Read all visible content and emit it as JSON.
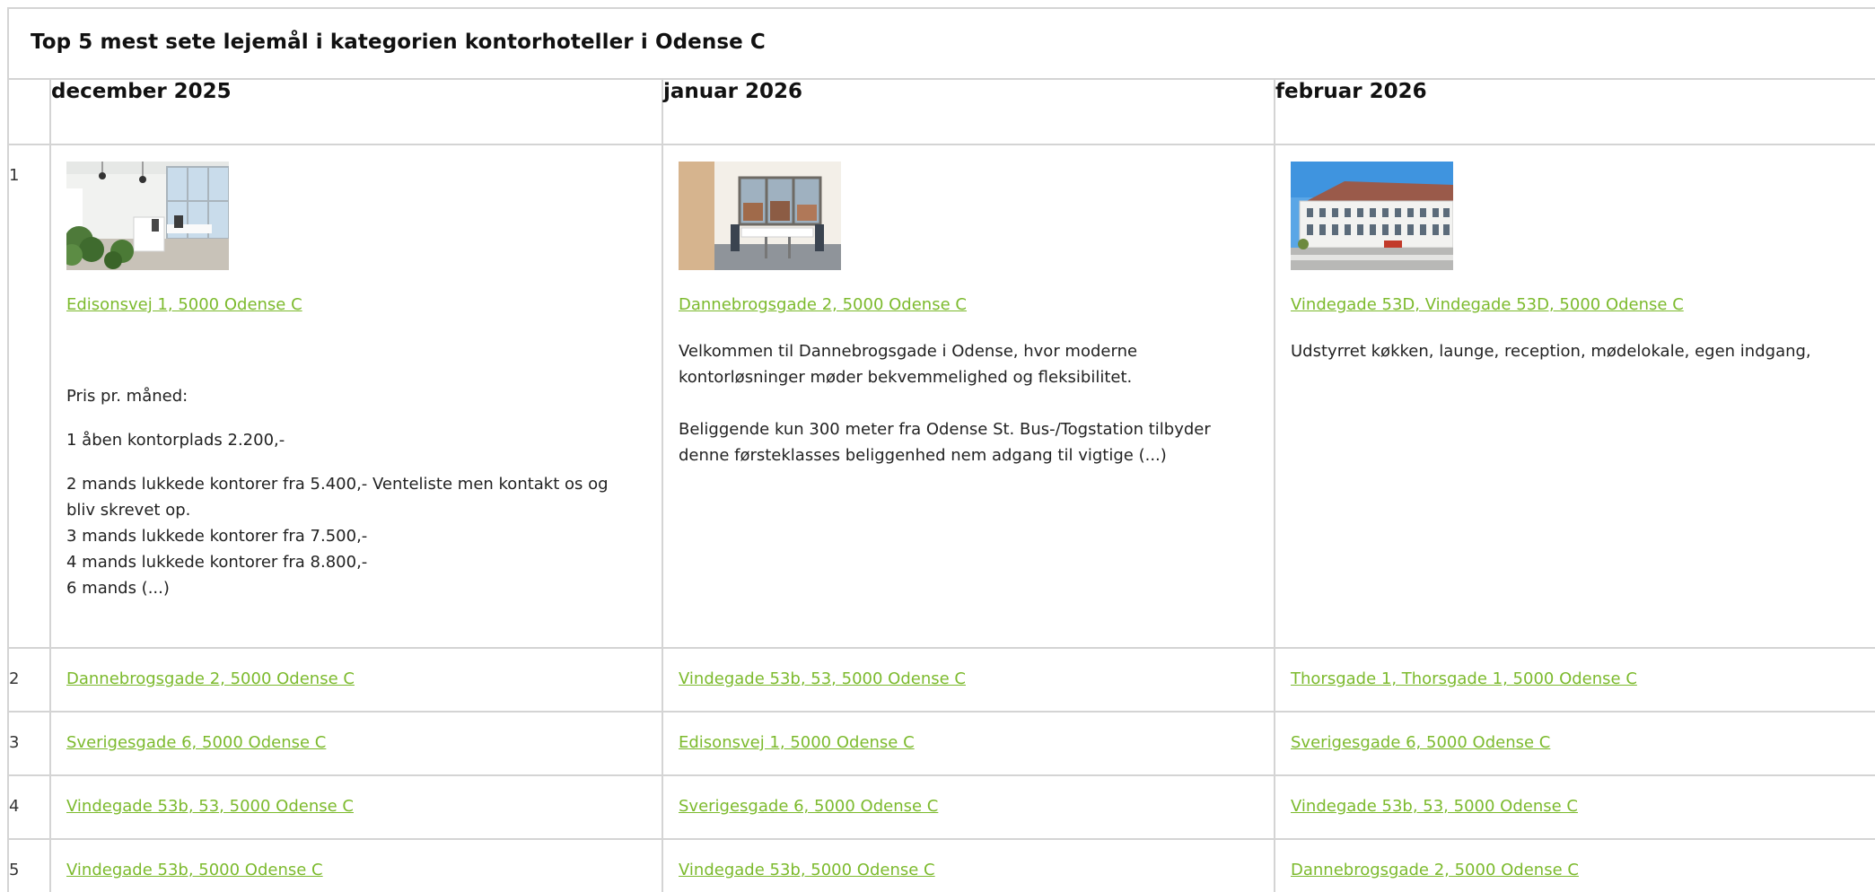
{
  "caption": "Top 5 mest sete lejemål i kategorien kontorhoteller i Odense C",
  "months": [
    "december 2025",
    "januar 2026",
    "februar 2026"
  ],
  "colors": {
    "link": "#7cba2d",
    "border": "#d4d4d4"
  },
  "first_row": {
    "rank": "1",
    "cells": [
      {
        "image": "office-interior-photo",
        "address": "Edisonsvej 1, 5000 Odense C",
        "lines": [
          "Pris pr. måned:",
          "1 åben kontorplads 2.200,-",
          "2 mands lukkede kontorer fra 5.400,- Venteliste men kontakt os og bliv skrevet op.",
          "3 mands lukkede kontorer fra 7.500,-",
          "4 mands lukkede kontorer fra 8.800,-",
          "6 mands (...)"
        ]
      },
      {
        "image": "meeting-room-photo",
        "address": "Dannebrogsgade 2, 5000 Odense C",
        "lines": [
          "Velkommen til Dannebrogsgade i Odense, hvor moderne kontorløsninger møder bekvemmelighed og fleksibilitet.",
          "Beliggende kun 300 meter fra Odense St. Bus-/Togstation tilbyder denne førsteklasses beliggenhed nem adgang til vigtige (...)"
        ]
      },
      {
        "image": "building-exterior-photo",
        "address": "Vindegade 53D, Vindegade 53D, 5000 Odense C",
        "lines": [
          "Udstyrret køkken, launge, reception, mødelokale, egen indgang,"
        ]
      }
    ]
  },
  "rows": [
    {
      "rank": "2",
      "addresses": [
        "Dannebrogsgade 2, 5000 Odense C",
        "Vindegade 53b, 53, 5000 Odense C",
        "Thorsgade 1, Thorsgade 1, 5000 Odense C"
      ]
    },
    {
      "rank": "3",
      "addresses": [
        "Sverigesgade 6, 5000 Odense C",
        "Edisonsvej 1, 5000 Odense C",
        "Sverigesgade 6, 5000 Odense C"
      ]
    },
    {
      "rank": "4",
      "addresses": [
        "Vindegade 53b, 53, 5000 Odense C",
        "Sverigesgade 6, 5000 Odense C",
        "Vindegade 53b, 53, 5000 Odense C"
      ]
    },
    {
      "rank": "5",
      "addresses": [
        "Vindegade 53b, 5000 Odense C",
        "Vindegade 53b, 5000 Odense C",
        "Dannebrogsgade 2, 5000 Odense C"
      ]
    }
  ]
}
